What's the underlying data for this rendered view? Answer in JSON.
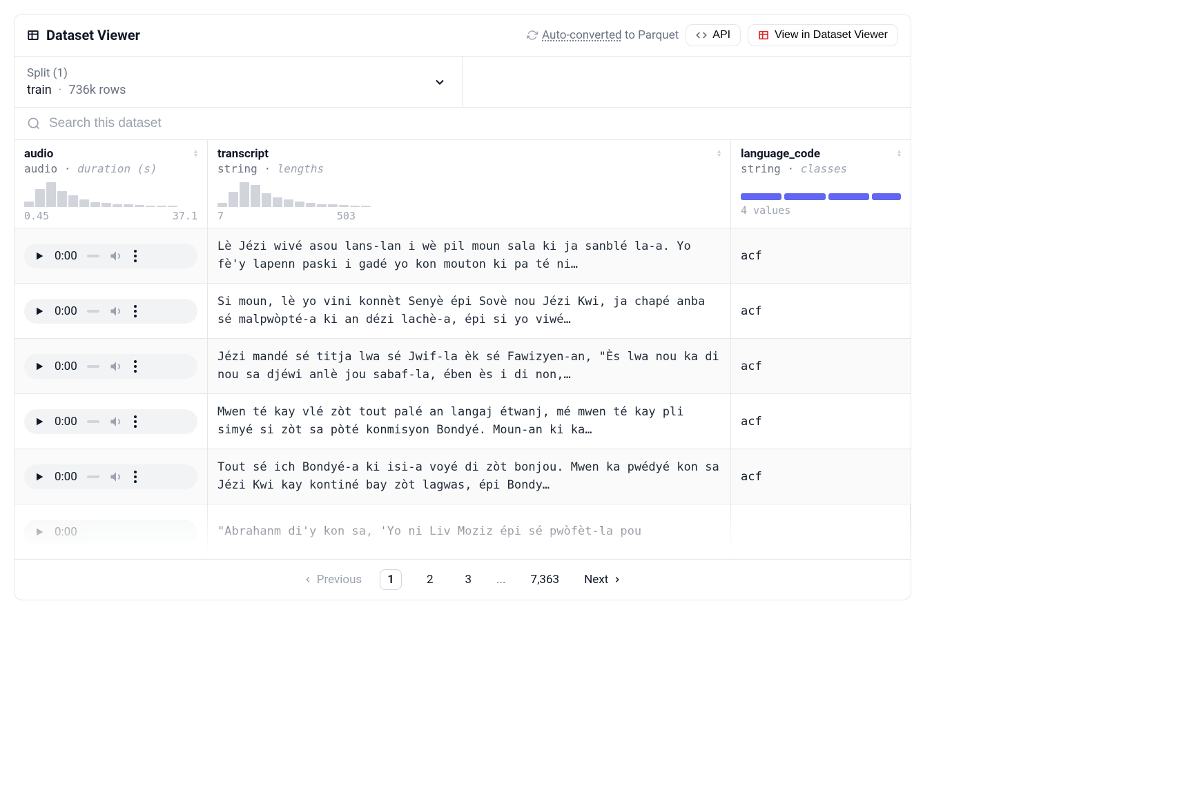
{
  "header": {
    "title": "Dataset Viewer",
    "auto_converted_prefix": "Auto-converted",
    "auto_converted_suffix": " to Parquet",
    "api_label": "API",
    "view_label": "View in Dataset Viewer"
  },
  "split": {
    "label": "Split (1)",
    "name": "train",
    "rows": "736k rows"
  },
  "search": {
    "placeholder": "Search this dataset"
  },
  "columns": {
    "audio": {
      "name": "audio",
      "type": "audio",
      "meta": "duration (s)",
      "min": "0.45",
      "max": "37.1",
      "bars": [
        22,
        72,
        100,
        64,
        48,
        30,
        20,
        18,
        12,
        10,
        8,
        6,
        5,
        5
      ]
    },
    "transcript": {
      "name": "transcript",
      "type": "string",
      "meta": "lengths",
      "min": "7",
      "max": "503",
      "bars": [
        18,
        60,
        100,
        90,
        55,
        40,
        30,
        22,
        16,
        12,
        10,
        8,
        6,
        5
      ]
    },
    "lang": {
      "name": "language_code",
      "type": "string",
      "meta": "classes",
      "values_label": "4 values"
    }
  },
  "rows": [
    {
      "time": "0:00",
      "transcript": "Lè Jézi wivé asou lans-lan i wè pil moun sala ki ja sanblé la-a. Yo fè'y lapenn paski i gadé yo kon mouton ki pa té ni…",
      "lang": "acf"
    },
    {
      "time": "0:00",
      "transcript": "Si moun, lè yo vini konnèt Senyè épi Sovè nou Jézi Kwi, ja chapé anba sé malpwòpté-a ki an dézi lachè-a, épi si yo viwé…",
      "lang": "acf"
    },
    {
      "time": "0:00",
      "transcript": "Jézi mandé sé titja lwa sé Jwif-la èk sé Fawizyen-an, \"Ès lwa nou ka di nou sa djéwi anlè jou sabaf-la, ében ès i di non,…",
      "lang": "acf"
    },
    {
      "time": "0:00",
      "transcript": "Mwen té kay vlé zòt tout palé an langaj étwanj, mé mwen té kay pli simyé si zòt sa pòté konmisyon Bondyé. Moun-an ki ka…",
      "lang": "acf"
    },
    {
      "time": "0:00",
      "transcript": "Tout sé ich Bondyé-a ki isi-a voyé di zòt bonjou. Mwen ka pwédyé kon sa Jézi Kwi kay kontiné bay zòt lagwas, épi Bondy…",
      "lang": "acf"
    }
  ],
  "last_row": {
    "time": "0:00",
    "transcript": "\"Abrahanm di'y kon sa, 'Yo ni Liv Moziz épi sé pwòfèt-la pou"
  },
  "pagination": {
    "prev": "Previous",
    "next": "Next",
    "pages": [
      "1",
      "2",
      "3"
    ],
    "ellipsis": "...",
    "last": "7,363"
  }
}
